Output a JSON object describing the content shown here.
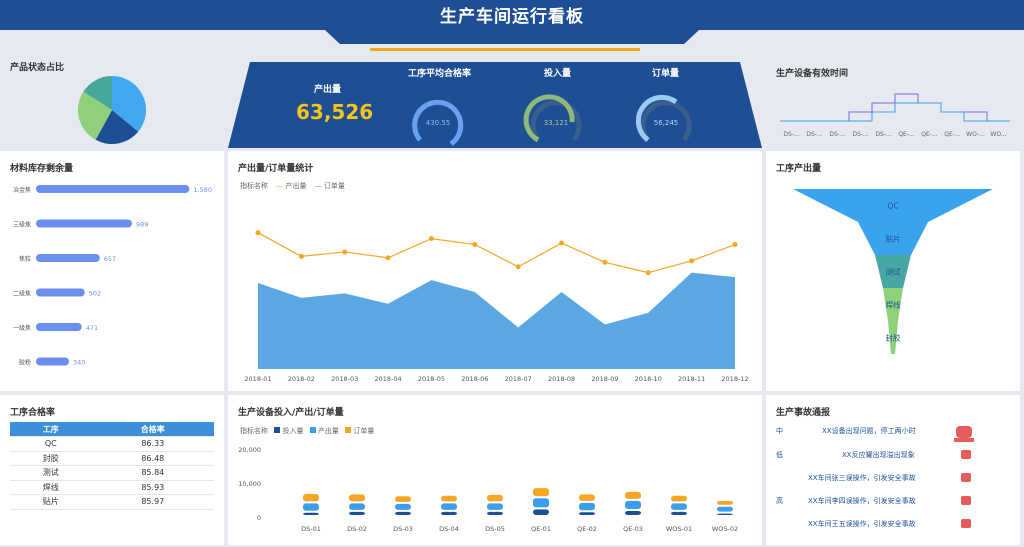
{
  "dashboard_title": "生产车间运行看板",
  "pie_panel": {
    "title": "产品状态占比"
  },
  "kpi": {
    "output_label": "产出量",
    "output_value": "63,526",
    "pass_label": "工序平均合格率",
    "pass_value": "430.55",
    "input_label": "投入量",
    "input_value": "33,121",
    "order_label": "订单量",
    "order_value": "56,245"
  },
  "uptime_panel": {
    "title": "生产设备有效时间",
    "labels": [
      "DS-...",
      "DS-...",
      "DS-...",
      "DS-...",
      "DS-...",
      "QE-...",
      "QE-...",
      "QE-...",
      "WO-...",
      "WO..."
    ]
  },
  "stock_panel": {
    "title": "材料库存剩余量"
  },
  "trend_panel": {
    "title": "产出量/订单量统计",
    "legend_name": "指标名称",
    "legend_output": "产出量",
    "legend_order": "订单量"
  },
  "funnel_panel": {
    "title": "工序产出量"
  },
  "pass_table": {
    "title": "工序合格率",
    "headers": [
      "工序",
      "合格率"
    ],
    "rows": [
      [
        "QC",
        "86.33"
      ],
      [
        "封胶",
        "86.48"
      ],
      [
        "测试",
        "85.84"
      ],
      [
        "焊线",
        "85.93"
      ],
      [
        "贴片",
        "85.97"
      ]
    ]
  },
  "equip_panel": {
    "title": "生产设备投入/产出/订单量",
    "legend_name": "指标名称",
    "legend_input": "投入量",
    "legend_output": "产出量",
    "legend_order": "订单量"
  },
  "accident_panel": {
    "title": "生产事故通报",
    "rows": [
      {
        "level": "中",
        "text": "XX设备出现问题，停工两小时"
      },
      {
        "level": "低",
        "text": "XX反应罐出现溢出现象"
      },
      {
        "level": "",
        "text": "XX车间张三误操作，引发安全事故"
      },
      {
        "level": "高",
        "text": "XX车间李四误操作，引发安全事故"
      },
      {
        "level": "",
        "text": "XX车间王五误操作，引发安全事故"
      }
    ]
  },
  "colors": {
    "header": "#1e4f95",
    "output": "#f5a623",
    "light_blue": "#3d9ee8",
    "dark_blue": "#1e4f95"
  },
  "chart_data": [
    {
      "type": "pie",
      "title": "",
      "values": [
        36,
        22,
        26,
        16
      ],
      "colors": [
        "#41a7f0",
        "#1e4f95",
        "#8fd17a",
        "#4aa89a"
      ]
    },
    {
      "type": "line",
      "title": "",
      "categories": [
        "DS-...",
        "DS-...",
        "DS-...",
        "DS-...",
        "DS-...",
        "QE-...",
        "QE-...",
        "QE-...",
        "WO-...",
        "WO..."
      ],
      "series": [
        {
          "values": [
            1,
            1,
            1,
            2,
            3,
            4,
            3,
            2,
            2,
            1
          ]
        },
        {
          "values": [
            1,
            1,
            1,
            1,
            2,
            3,
            3,
            2,
            1,
            1
          ]
        }
      ]
    },
    {
      "type": "bar",
      "title": "",
      "categories": [
        "冶金焦",
        "三级焦",
        "焦粒",
        "二级焦",
        "一级焦",
        "胶粉"
      ],
      "values": [
        1580,
        989,
        657,
        502,
        471,
        340
      ]
    },
    {
      "type": "line",
      "title": "",
      "categories": [
        "2018-01",
        "2018-02",
        "2018-03",
        "2018-04",
        "2018-05",
        "2018-06",
        "2018-07",
        "2018-08",
        "2018-09",
        "2018-10",
        "2018-11",
        "2018-12"
      ],
      "series": [
        {
          "name": "产出量",
          "type": "area",
          "values": [
            58,
            48,
            51,
            44,
            60,
            52,
            28,
            52,
            30,
            38,
            65,
            62
          ]
        },
        {
          "name": "订单量",
          "type": "line",
          "values": [
            92,
            76,
            79,
            75,
            88,
            84,
            69,
            85,
            72,
            65,
            73,
            84
          ]
        }
      ],
      "ylim": [
        0,
        110
      ]
    },
    {
      "type": "funnel",
      "title": "",
      "categories": [
        "QC",
        "贴片",
        "测试",
        "焊线",
        "封胶"
      ],
      "values": [
        100,
        35,
        18,
        10,
        5
      ],
      "colors": [
        "#3aa3ee",
        "#3aa3ee",
        "#46a7a5",
        "#8fd17a",
        "#8fd17a"
      ]
    },
    {
      "type": "bar",
      "title": "",
      "stacked": true,
      "categories": [
        "DS-01",
        "DS-02",
        "DS-03",
        "DS-04",
        "DS-05",
        "QE-01",
        "QE-02",
        "QE-03",
        "WOS-01",
        "WOS-02"
      ],
      "series": [
        {
          "name": "投入量",
          "values": [
            2500,
            3000,
            3000,
            3000,
            3000,
            4500,
            2800,
            3500,
            3000,
            2000
          ]
        },
        {
          "name": "产出量",
          "values": [
            5500,
            5000,
            4700,
            5000,
            5000,
            6500,
            5500,
            6000,
            5000,
            4000
          ]
        },
        {
          "name": "订单量",
          "values": [
            5500,
            5300,
            4500,
            4500,
            5000,
            6000,
            5000,
            5300,
            4500,
            3500
          ]
        }
      ],
      "ylim": [
        0,
        20000
      ],
      "yticks": [
        "0",
        "10,000",
        "20,000"
      ]
    }
  ]
}
